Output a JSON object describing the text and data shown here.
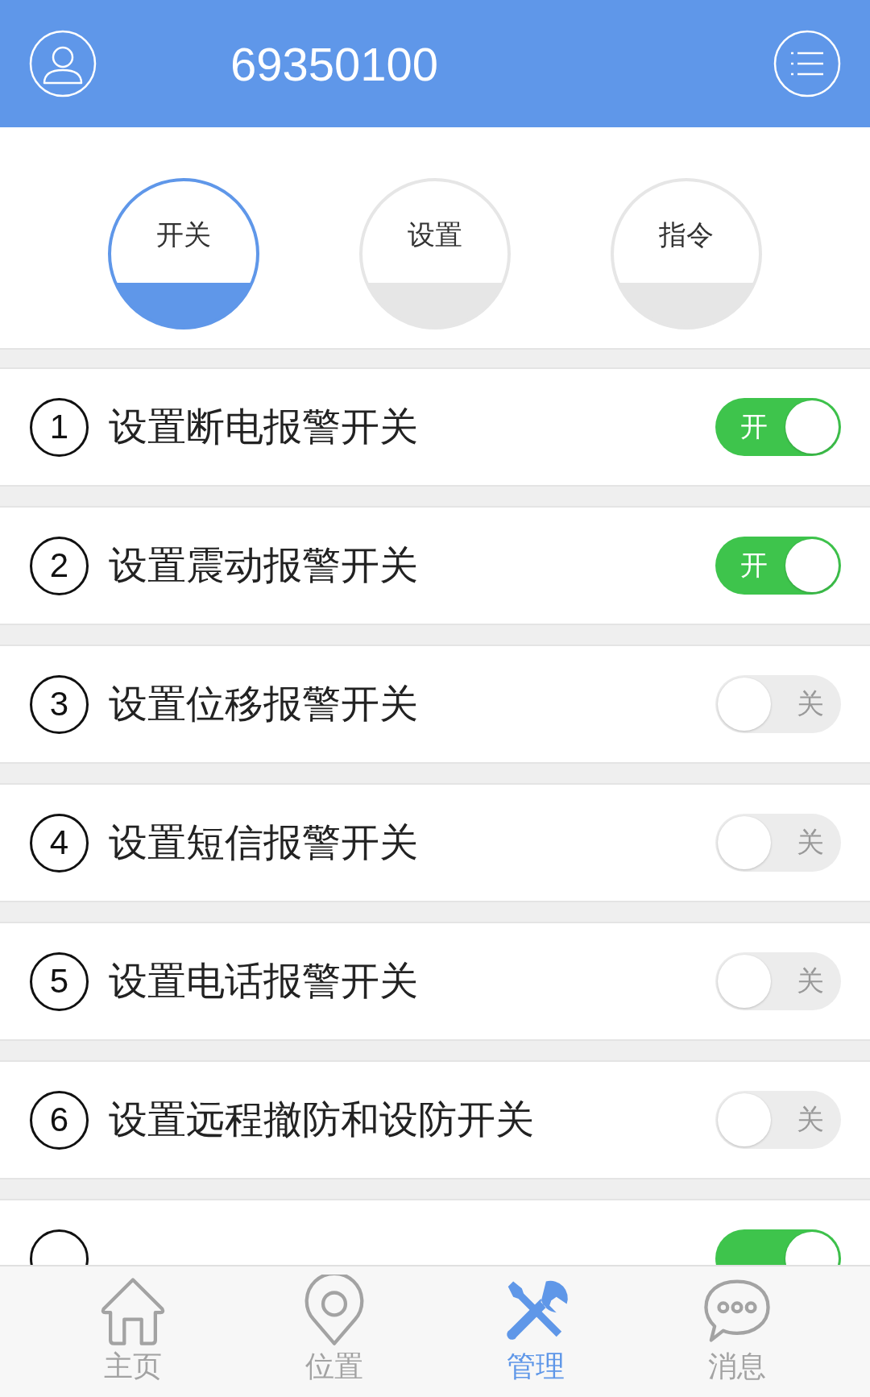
{
  "header": {
    "title": "69350100"
  },
  "tabs": [
    {
      "label": "开关",
      "selected": true
    },
    {
      "label": "设置",
      "selected": false
    },
    {
      "label": "指令",
      "selected": false
    }
  ],
  "switches": [
    {
      "number": "1",
      "label": "设置断电报警开关",
      "on": true,
      "state_text": "开"
    },
    {
      "number": "2",
      "label": "设置震动报警开关",
      "on": true,
      "state_text": "开"
    },
    {
      "number": "3",
      "label": "设置位移报警开关",
      "on": false,
      "state_text": "关"
    },
    {
      "number": "4",
      "label": "设置短信报警开关",
      "on": false,
      "state_text": "关"
    },
    {
      "number": "5",
      "label": "设置电话报警开关",
      "on": false,
      "state_text": "关"
    },
    {
      "number": "6",
      "label": "设置远程撤防和设防开关",
      "on": false,
      "state_text": "关"
    },
    {
      "on": true
    }
  ],
  "nav": [
    {
      "kind": "home",
      "label": "主页",
      "selected": false
    },
    {
      "kind": "location",
      "label": "位置",
      "selected": false
    },
    {
      "kind": "tools",
      "label": "管理",
      "selected": true
    },
    {
      "kind": "message",
      "label": "消息",
      "selected": false
    }
  ]
}
